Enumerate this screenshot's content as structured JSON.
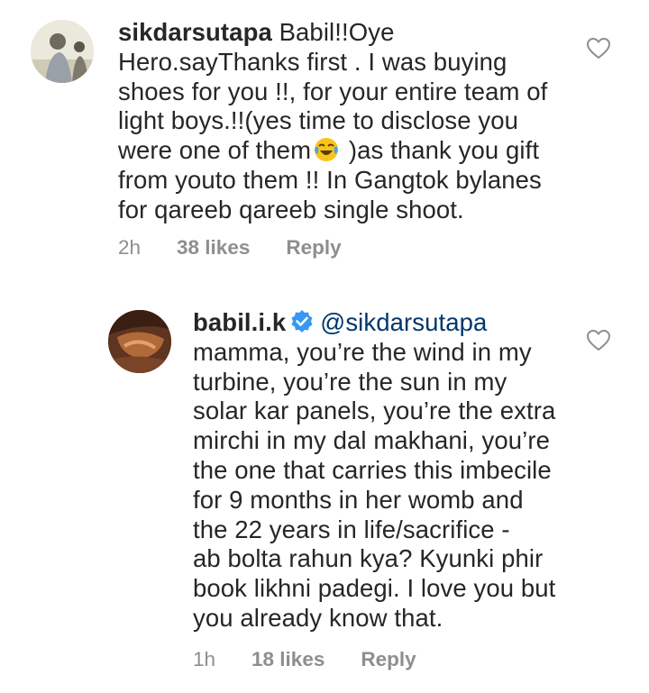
{
  "comments": [
    {
      "username": "sikdarsutapa",
      "text_before_emoji": " Babil!!Oye\nHero.sayThanks first . I was buying\nshoes for you !!, for your entire team of\nlight boys.!!(yes time to disclose you\nwere one of them",
      "emoji": "face-with-tears-of-joy-emoji",
      "text_after_emoji": " )as thank you gift\nfrom youto them !! In Gangtok bylanes\nfor qareeb qareeb single shoot.",
      "time": "2h",
      "likes": "38 likes",
      "reply_label": "Reply"
    },
    {
      "username": "babil.i.k",
      "verified": true,
      "mention": "@sikdarsutapa",
      "text": "mamma, you’re the wind in my\nturbine, you’re the sun in my\nsolar kar panels, you’re the extra\nmirchi in my dal makhani, you’re\nthe one that carries this imbecile\nfor 9 months in her womb and\nthe 22 years in life/sacrifice -\nab bolta rahun kya? Kyunki phir\nbook likhni padegi. I love you but\nyou already know that.",
      "time": "1h",
      "likes": "18 likes",
      "reply_label": "Reply"
    }
  ],
  "colors": {
    "text": "#262626",
    "meta": "#8e8e8e",
    "mention": "#00376b",
    "verified": "#3897f0"
  },
  "icons": [
    "heart-outline-icon",
    "verified-badge-icon"
  ]
}
